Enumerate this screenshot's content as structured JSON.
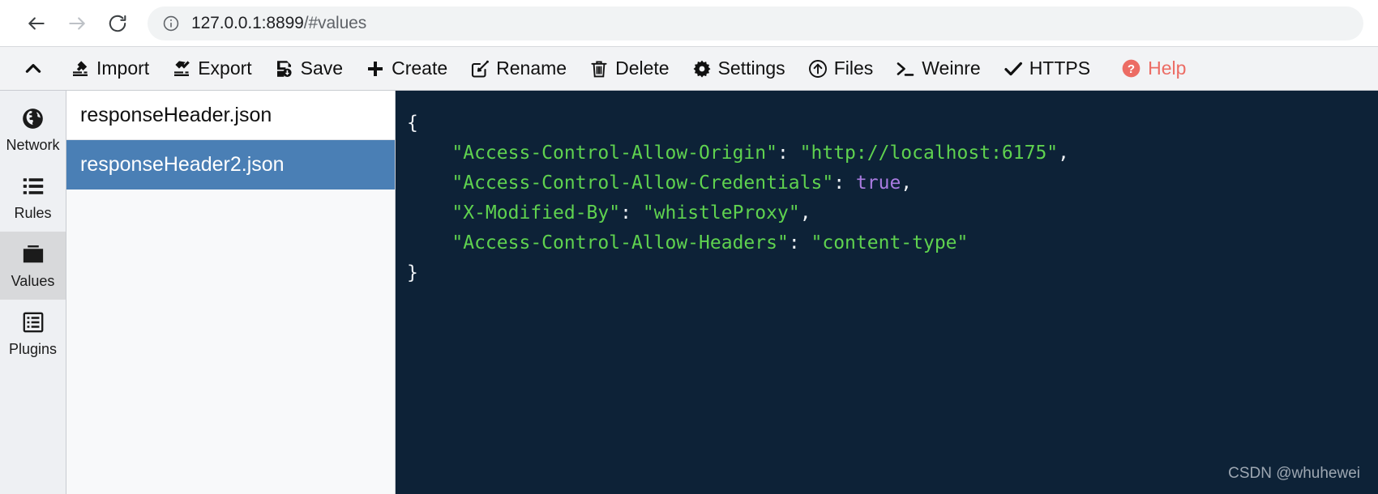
{
  "browser": {
    "back_icon": "arrow-left-icon",
    "forward_icon": "arrow-right-icon",
    "reload_icon": "reload-icon",
    "site_info_icon": "info-circle-icon",
    "url_host": "127.0.0.1:8899",
    "url_path": "/#values",
    "url_full": "127.0.0.1:8899/#values"
  },
  "toolbar": {
    "collapse_label": "",
    "collapse_icon": "chevron-up-icon",
    "help_color": "#ec6c64",
    "items": [
      {
        "label": "Import",
        "icon": "import-icon"
      },
      {
        "label": "Export",
        "icon": "export-icon"
      },
      {
        "label": "Save",
        "icon": "save-icon"
      },
      {
        "label": "Create",
        "icon": "plus-icon"
      },
      {
        "label": "Rename",
        "icon": "edit-square-icon"
      },
      {
        "label": "Delete",
        "icon": "trash-icon"
      },
      {
        "label": "Settings",
        "icon": "gear-icon"
      },
      {
        "label": "Files",
        "icon": "upload-circle-icon"
      },
      {
        "label": "Weinre",
        "icon": "terminal-icon"
      },
      {
        "label": "HTTPS",
        "icon": "check-icon"
      },
      {
        "label": "Help",
        "icon": "question-circle-icon"
      }
    ]
  },
  "sidebar": {
    "active": "Values",
    "items": [
      {
        "label": "Network",
        "icon": "globe-icon"
      },
      {
        "label": "Rules",
        "icon": "list-icon"
      },
      {
        "label": "Values",
        "icon": "folder-icon"
      },
      {
        "label": "Plugins",
        "icon": "plugins-icon"
      }
    ]
  },
  "filelist": {
    "selected": "responseHeader2.json",
    "items": [
      {
        "name": "responseHeader.json",
        "selected": false
      },
      {
        "name": "responseHeader2.json",
        "selected": true
      }
    ]
  },
  "editor": {
    "watermark": "CSDN @whuhewei",
    "lines": [
      [
        {
          "t": "{",
          "c": "punc"
        }
      ],
      [
        {
          "t": "    ",
          "c": "punc"
        },
        {
          "t": "\"Access-Control-Allow-Origin\"",
          "c": "key"
        },
        {
          "t": ": ",
          "c": "punc"
        },
        {
          "t": "\"http://localhost:6175\"",
          "c": "str"
        },
        {
          "t": ",",
          "c": "punc"
        }
      ],
      [
        {
          "t": "    ",
          "c": "punc"
        },
        {
          "t": "\"Access-Control-Allow-Credentials\"",
          "c": "key"
        },
        {
          "t": ": ",
          "c": "punc"
        },
        {
          "t": "true",
          "c": "bool"
        },
        {
          "t": ",",
          "c": "punc"
        }
      ],
      [
        {
          "t": "    ",
          "c": "punc"
        },
        {
          "t": "\"X-Modified-By\"",
          "c": "key"
        },
        {
          "t": ": ",
          "c": "punc"
        },
        {
          "t": "\"whistleProxy\"",
          "c": "str"
        },
        {
          "t": ",",
          "c": "punc"
        }
      ],
      [
        {
          "t": "    ",
          "c": "punc"
        },
        {
          "t": "\"Access-Control-Allow-Headers\"",
          "c": "key"
        },
        {
          "t": ": ",
          "c": "punc"
        },
        {
          "t": "\"content-type\"",
          "c": "str"
        }
      ],
      [
        {
          "t": "}",
          "c": "punc"
        }
      ]
    ]
  }
}
